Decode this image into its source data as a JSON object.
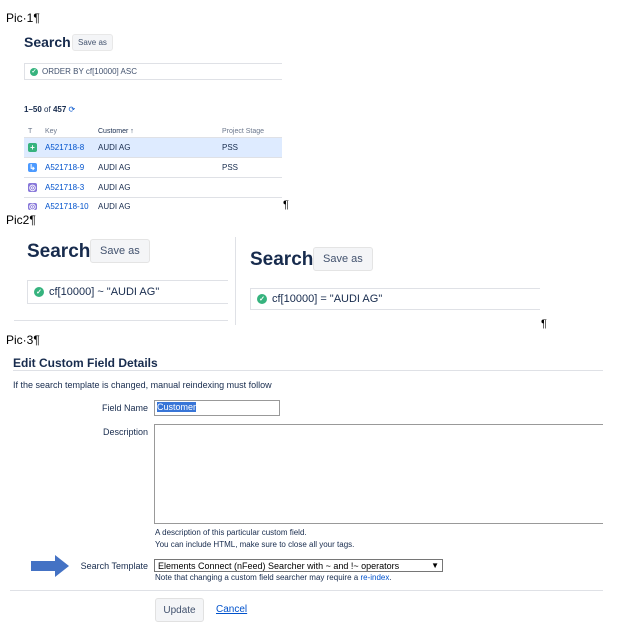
{
  "captions": {
    "pic1": "Pic·1¶",
    "pic2": "Pic2¶",
    "pic3": "Pic·3¶",
    "pilcrow": "¶"
  },
  "pic1": {
    "title": "Search",
    "save_as": "Save as",
    "jql": "ORDER BY cf[10000] ASC",
    "count_range": "1–50",
    "count_of": "of",
    "count_total": "457",
    "headers": {
      "type": "T",
      "key": "Key",
      "customer": "Customer ↑",
      "stage": "Project Stage"
    },
    "rows": [
      {
        "icon": "story-icon",
        "icon_color": "#36b37e",
        "key": "A521718-8",
        "customer": "AUDI AG",
        "stage": "PSS"
      },
      {
        "icon": "subtask-icon",
        "icon_color": "#4c9aff",
        "key": "A521718-9",
        "customer": "AUDI AG",
        "stage": "PSS"
      },
      {
        "icon": "epic-icon",
        "icon_color": "#8777d9",
        "key": "A521718-3",
        "customer": "AUDI AG",
        "stage": ""
      },
      {
        "icon": "epic-icon",
        "icon_color": "#8777d9",
        "key": "A521718-10",
        "customer": "AUDI AG",
        "stage": ""
      }
    ]
  },
  "pic2": {
    "left": {
      "title": "Search",
      "save_as": "Save as",
      "jql": "cf[10000] ~ \"AUDI AG\""
    },
    "right": {
      "title": "Search",
      "save_as": "Save as",
      "jql": "cf[10000] = \"AUDI AG\""
    }
  },
  "pic3": {
    "heading": "Edit Custom Field Details",
    "note": "If the search template is changed, manual reindexing must follow",
    "field_name_label": "Field Name",
    "field_name_value": "Customer",
    "description_label": "Description",
    "description_help_1": "A description of this particular custom field.",
    "description_help_2": "You can include HTML, make sure to close all your tags.",
    "search_template_label": "Search Template",
    "search_template_value": "Elements Connect (nFeed) Searcher with ~ and !~ operators",
    "template_note_prefix": "Note that changing a custom field searcher may require a",
    "template_note_link": "re-index",
    "template_note_suffix": ".",
    "update_label": "Update",
    "cancel_label": "Cancel"
  },
  "colors": {
    "accent": "#0052cc",
    "success": "#36b37e",
    "arrow": "#4472c4",
    "selected_row": "#deebff"
  }
}
